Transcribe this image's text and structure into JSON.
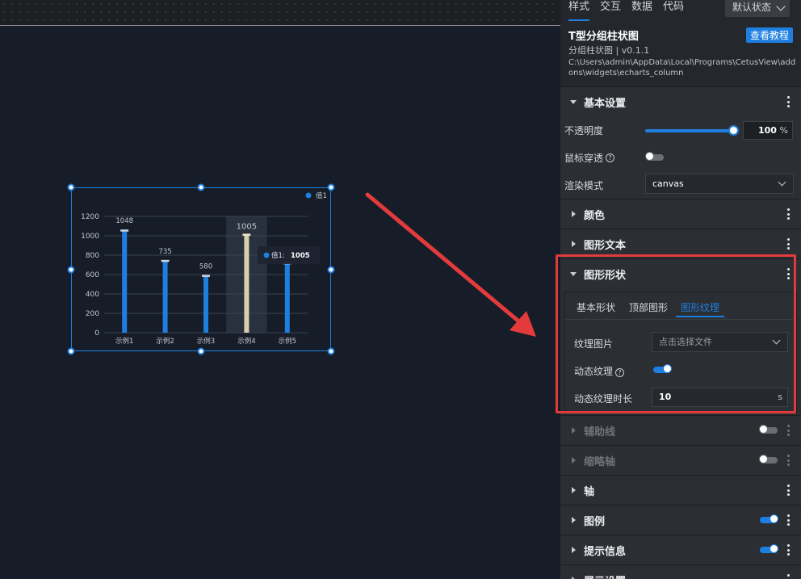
{
  "panel_tabs": {
    "style": "样式",
    "interaction": "交互",
    "data": "数据",
    "code": "代码"
  },
  "state_select": "默认状态",
  "info": {
    "title": "T型分组柱状图",
    "subtitle": "分组柱状图 | v0.1.1",
    "path": "C:\\Users\\admin\\AppData\\Local\\Programs\\CetusView\\addons\\widgets\\echarts_column",
    "tutorial_button": "查看教程"
  },
  "basic": {
    "title": "基本设置",
    "opacity_label": "不透明度",
    "opacity_value": "100",
    "opacity_unit": "%",
    "opacity_level": 1.0,
    "mouse_through_label": "鼠标穿透",
    "render_mode_label": "渲染模式",
    "render_mode_value": "canvas"
  },
  "sections": {
    "color": "颜色",
    "shape_text": "图形文本",
    "shape": "图形形状",
    "aux_line": "辅助线",
    "zoom_axis": "缩略轴",
    "axis": "轴",
    "legend": "图例",
    "tooltip": "提示信息",
    "display": "展示设置"
  },
  "shape_panel": {
    "tabs": {
      "basic": "基本形状",
      "top": "顶部图形",
      "texture": "图形纹理"
    },
    "texture_image_label": "纹理图片",
    "texture_image_placeholder": "点击选择文件",
    "dynamic_texture_label": "动态纹理",
    "dynamic_duration_label": "动态纹理时长",
    "dynamic_duration_value": "10",
    "dynamic_duration_unit": "s"
  },
  "help_glyph": "?",
  "chart_data": {
    "type": "bar",
    "categories": [
      "示例1",
      "示例2",
      "示例3",
      "示例4",
      "示例5"
    ],
    "series": [
      {
        "name": "值1",
        "values": [
          1048,
          735,
          580,
          1005,
          710
        ]
      }
    ],
    "data_labels": [
      "1048",
      "735",
      "580",
      "1005"
    ],
    "yticks": [
      "0",
      "200",
      "400",
      "600",
      "800",
      "1000",
      "1200"
    ],
    "ylim": [
      0,
      1200
    ],
    "highlighted_index": 3,
    "tooltip": {
      "series": "值1:",
      "value": "1005"
    },
    "legend_position": "top-right",
    "colors": {
      "bar": "#1e7fe0",
      "highlight": "#d9cfae"
    }
  }
}
